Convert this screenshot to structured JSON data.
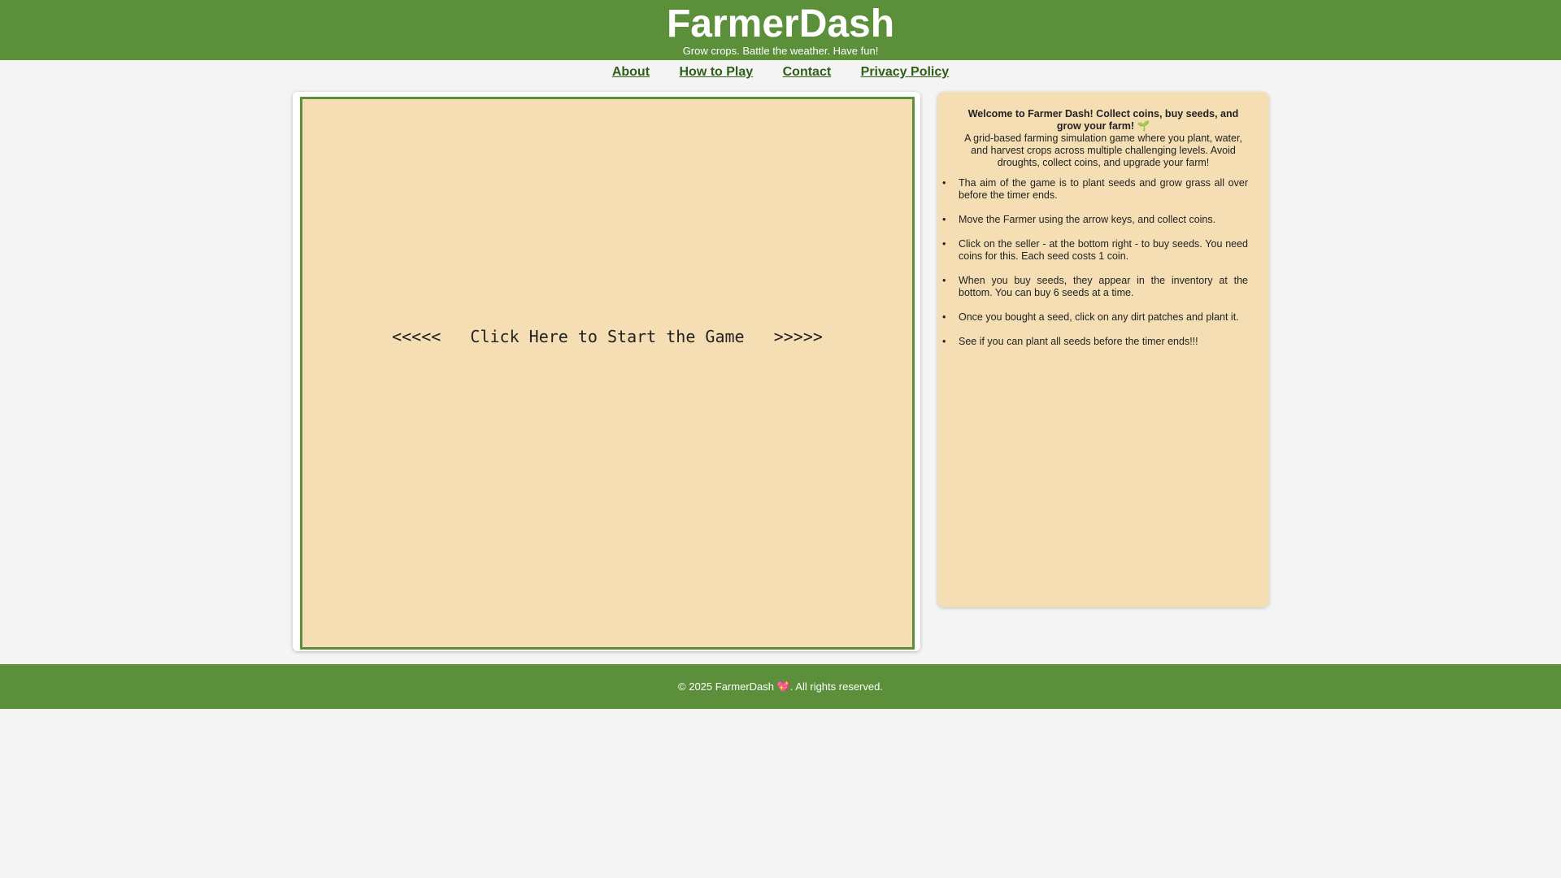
{
  "header": {
    "title": "FarmerDash",
    "tagline": "Grow crops. Battle the weather. Have fun!"
  },
  "nav": {
    "items": [
      "About",
      "How to Play",
      "Contact",
      "Privacy Policy"
    ]
  },
  "game": {
    "start_text": "<<<<<   Click Here to Start the Game   >>>>>"
  },
  "info": {
    "welcome": "Welcome to Farmer Dash! Collect coins, buy seeds, and grow your farm! 🌱",
    "description": "A grid-based farming simulation game where you plant, water, and harvest crops across multiple challenging levels. Avoid droughts, collect coins, and upgrade your farm!",
    "rules": [
      "Tha aim of the game is to plant seeds and grow grass all over before the timer ends.",
      "Move the Farmer using the arrow keys, and collect coins.",
      "Click on the seller - at the bottom right - to buy seeds. You need coins for this. Each seed costs 1 coin.",
      "When you buy seeds, they appear in the inventory at the bottom. You can buy 6 seeds at a time.",
      "Once you bought a seed, click on any dirt patches and plant it.",
      "See if you can plant all seeds before the timer ends!!!"
    ]
  },
  "footer": {
    "prefix": "© 2025 FarmerDash ",
    "heart": "💖",
    "suffix": ". All rights reserved."
  },
  "colors": {
    "header_green": "#5b8f3a",
    "nav_link": "#2f5f16",
    "panel_tan": "#f5deb3",
    "page_bg": "#f4f4f4"
  }
}
